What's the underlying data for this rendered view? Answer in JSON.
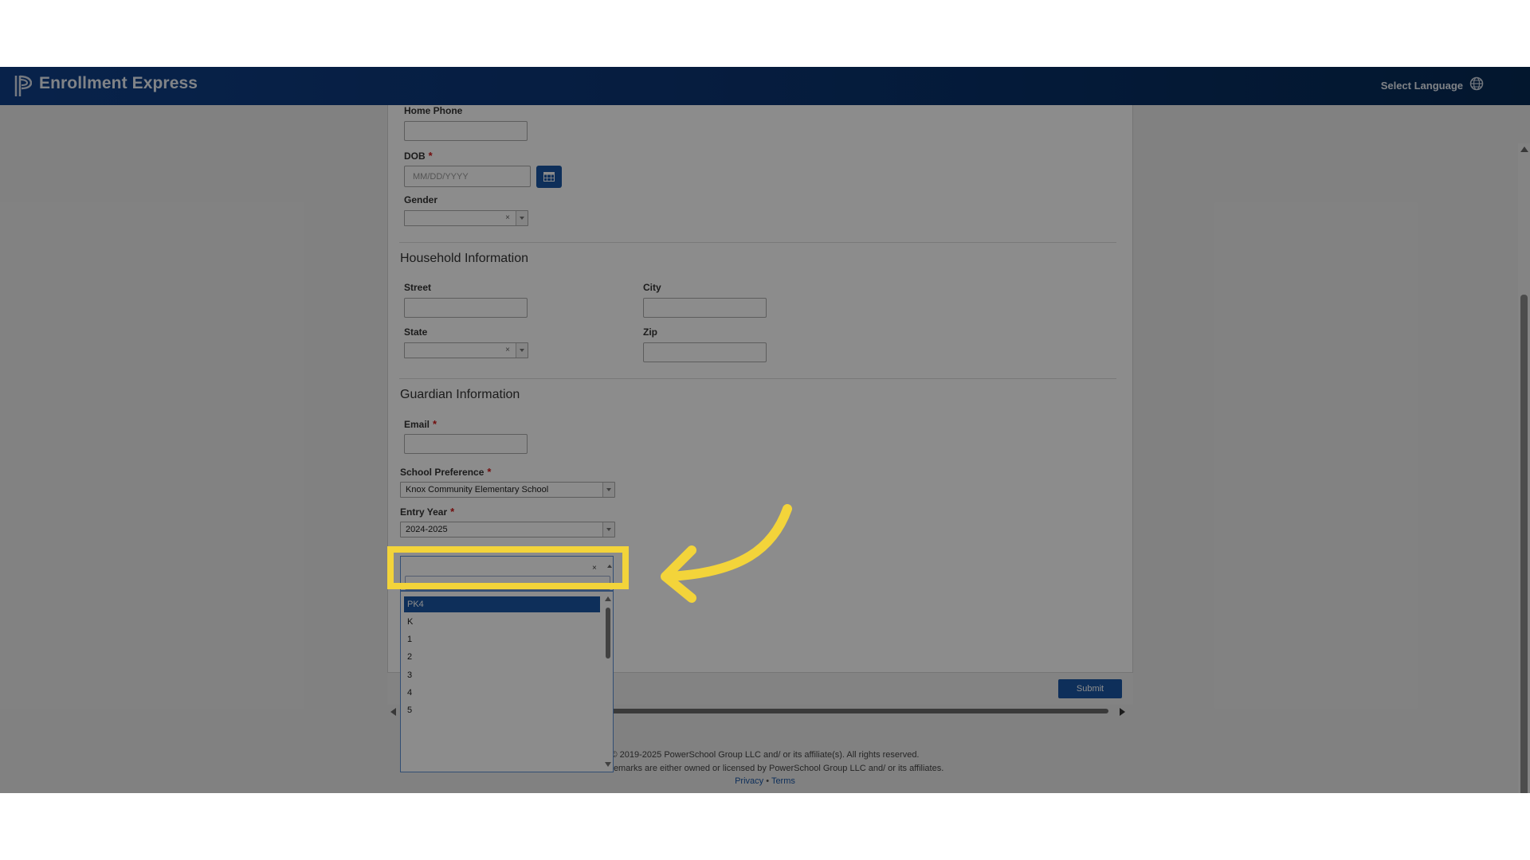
{
  "header": {
    "app_title": "Enrollment Express",
    "select_language": "Select Language",
    "logo_icon": "powerschool-logo-icon",
    "language_icon": "globe-icon"
  },
  "form": {
    "home_phone": {
      "label": "Home Phone",
      "value": ""
    },
    "dob": {
      "label": "DOB",
      "required": "*",
      "placeholder": "MM/DD/YYYY",
      "calendar_icon": "calendar-icon"
    },
    "gender": {
      "label": "Gender",
      "value": "",
      "clear": "×"
    },
    "household": {
      "title": "Household Information",
      "street": {
        "label": "Street",
        "value": ""
      },
      "city": {
        "label": "City",
        "value": ""
      },
      "state": {
        "label": "State",
        "value": "",
        "clear": "×"
      },
      "zip": {
        "label": "Zip",
        "value": ""
      }
    },
    "guardian": {
      "title": "Guardian Information",
      "email": {
        "label": "Email",
        "required": "*",
        "value": ""
      },
      "school_preference": {
        "label": "School Preference",
        "required": "*",
        "value": "Knox Community Elementary School"
      },
      "entry_year": {
        "label": "Entry Year",
        "required": "*",
        "value": "2024-2025"
      },
      "grade": {
        "value": "",
        "clear": "×",
        "search_value": "",
        "options": [
          "PK4",
          "K",
          "1",
          "2",
          "3",
          "4",
          "5"
        ],
        "highlighted": "PK4"
      }
    },
    "submit_label": "Submit"
  },
  "footer": {
    "copyright": "© 2019-2025 PowerSchool Group LLC and/ or its affiliate(s). All rights reserved.",
    "trademarks": "All trademarks are either owned or licensed by PowerSchool Group LLC and/ or its affiliates.",
    "privacy": "Privacy",
    "separator": "•",
    "terms": "Terms"
  },
  "annotation": {
    "highlight_color": "#f3d43a",
    "overlay_color": "rgba(0,0,0,0.45)",
    "arrow_icon": "curved-arrow-icon"
  },
  "colors": {
    "header_blue": "#0b3574",
    "button_blue": "#1a56a4",
    "required_red": "#d01818"
  }
}
